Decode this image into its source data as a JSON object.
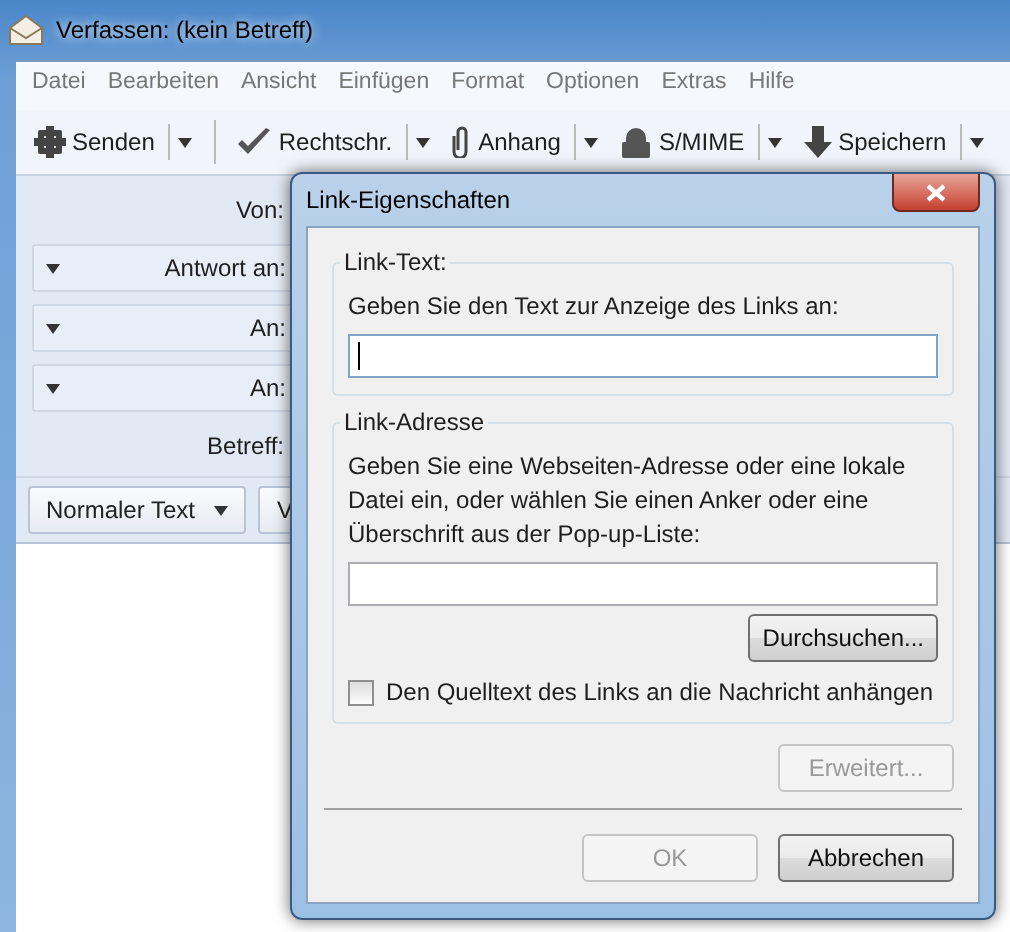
{
  "window": {
    "title": "Verfassen: (kein Betreff)"
  },
  "menu": [
    "Datei",
    "Bearbeiten",
    "Ansicht",
    "Einfügen",
    "Format",
    "Optionen",
    "Extras",
    "Hilfe"
  ],
  "toolbar": [
    {
      "label": "Senden",
      "kind": "send"
    },
    {
      "label": "Rechtschr.",
      "kind": "check"
    },
    {
      "label": "Anhang",
      "kind": "clip"
    },
    {
      "label": "S/MIME",
      "kind": "lock"
    },
    {
      "label": "Speichern",
      "kind": "save"
    }
  ],
  "header_fields": [
    {
      "label": "Von:",
      "kind": "plain"
    },
    {
      "label": "Antwort an:",
      "kind": "dropdown"
    },
    {
      "label": "An:",
      "kind": "dropdown"
    },
    {
      "label": "An:",
      "kind": "dropdown"
    },
    {
      "label": "Betreff:",
      "kind": "plain"
    }
  ],
  "format_bar": [
    {
      "label": "Normaler Text",
      "kind": "dropdown"
    },
    {
      "label": "V",
      "kind": "plain"
    }
  ],
  "dialog": {
    "title": "Link-Eigenschaften",
    "link_text": {
      "legend": "Link-Text:",
      "prompt": "Geben Sie den Text zur Anzeige des Links an:",
      "focused": true
    },
    "link_address": {
      "legend": "Link-Adresse",
      "prompt": "Geben Sie eine Webseiten-Adresse oder eine lokale Datei ein, oder wählen Sie einen Anker oder eine Überschrift aus der Pop-up-Liste:",
      "browse_button": "Durchsuchen..."
    },
    "checkbox": {
      "label": "Den Quelltext des Links an die Nachricht anhängen",
      "checked": false
    },
    "advanced_button": {
      "label": "Erweitert...",
      "disabled": true
    },
    "buttons": [
      {
        "label": "OK",
        "disabled": true
      },
      {
        "label": "Abbrechen",
        "disabled": false
      }
    ]
  }
}
